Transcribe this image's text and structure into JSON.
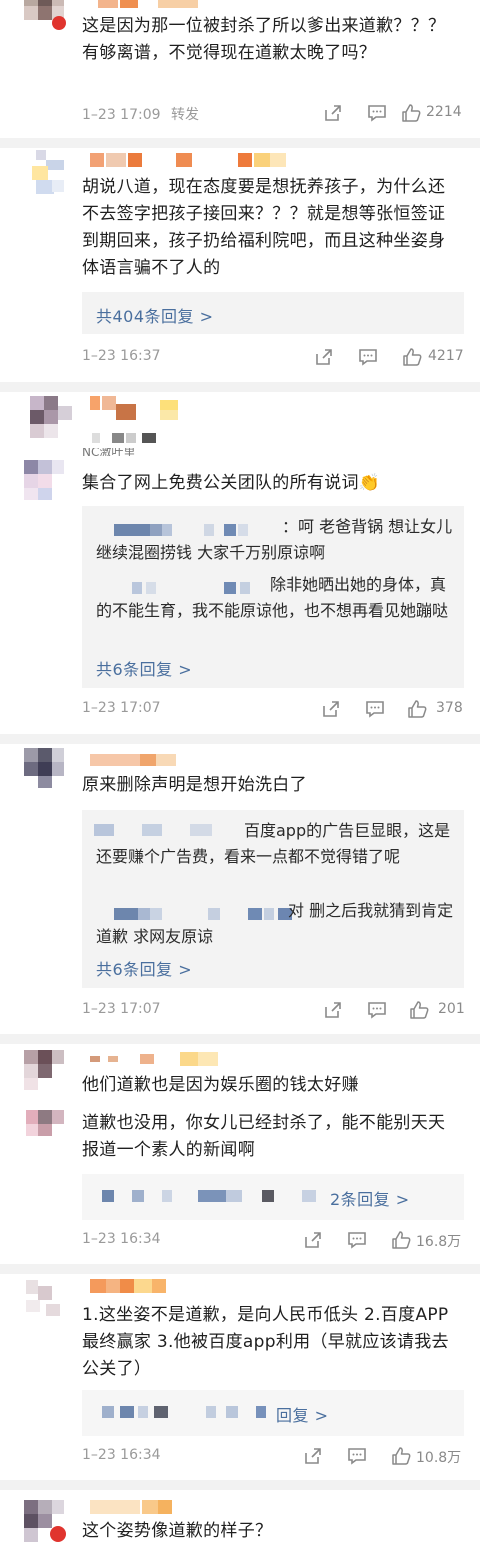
{
  "comments": [
    {
      "text": "这是因为那一位被封杀了所以爹出来道歉？？？有够离谱，不觉得现在道歉太晚了吗？",
      "time": "1–23 17:09",
      "forward": "转发",
      "likes": "2214"
    },
    {
      "text": "胡说八道，现在态度要是想抚养孩子，为什么还不去签字把孩子接回来？？？就是想等张恒签证到期回来，孩子扔给福利院吧，而且这种坐姿身体语言骗不了人的",
      "reply_more": "共404条回复 >",
      "time": "1–23 16:37",
      "likes": "4217"
    },
    {
      "partial_name": "NC激叶里"
    },
    {
      "text": "集合了网上免费公关团队的所有说词👏",
      "replies": [
        "：呵 老爸背锅 想让女儿继续混圈捞钱 大家千万别原谅啊",
        "除非她晒出她的身体，真的不能生育，我不能原谅他，也不想再看见她蹦哒"
      ],
      "reply_more": "共6条回复 >",
      "time": "1–23 17:07",
      "likes": "378"
    },
    {
      "text": "原来删除声明是想开始洗白了",
      "replies": [
        "百度app的广告巨显眼，这是还要赚个广告费，看来一点都不觉得错了呢",
        "对 删之后我就猜到肯定道歉 求网友原谅"
      ],
      "reply_more": "共6条回复 >",
      "time": "1–23 17:07",
      "likes": "201"
    },
    {
      "text": "他们道歉也是因为娱乐圈的钱太好赚",
      "second_text": "道歉也没用，你女儿已经封杀了，能不能别天天报道一个素人的新闻啊",
      "reply_more": "2条回复 >",
      "time": "1–23 16:34",
      "likes": "16.8万"
    },
    {
      "text": "1.这坐姿不是道歉，是向人民币低头 2.百度APP最终赢家 3.他被百度app利用（早就应该请我去公关了）",
      "reply_more": "回复 >",
      "time": "1–23 16:34",
      "likes": "10.8万"
    },
    {
      "text": "这个姿势像道歉的样子？"
    }
  ],
  "icons": [
    "share-icon",
    "comment-icon",
    "like-icon"
  ]
}
